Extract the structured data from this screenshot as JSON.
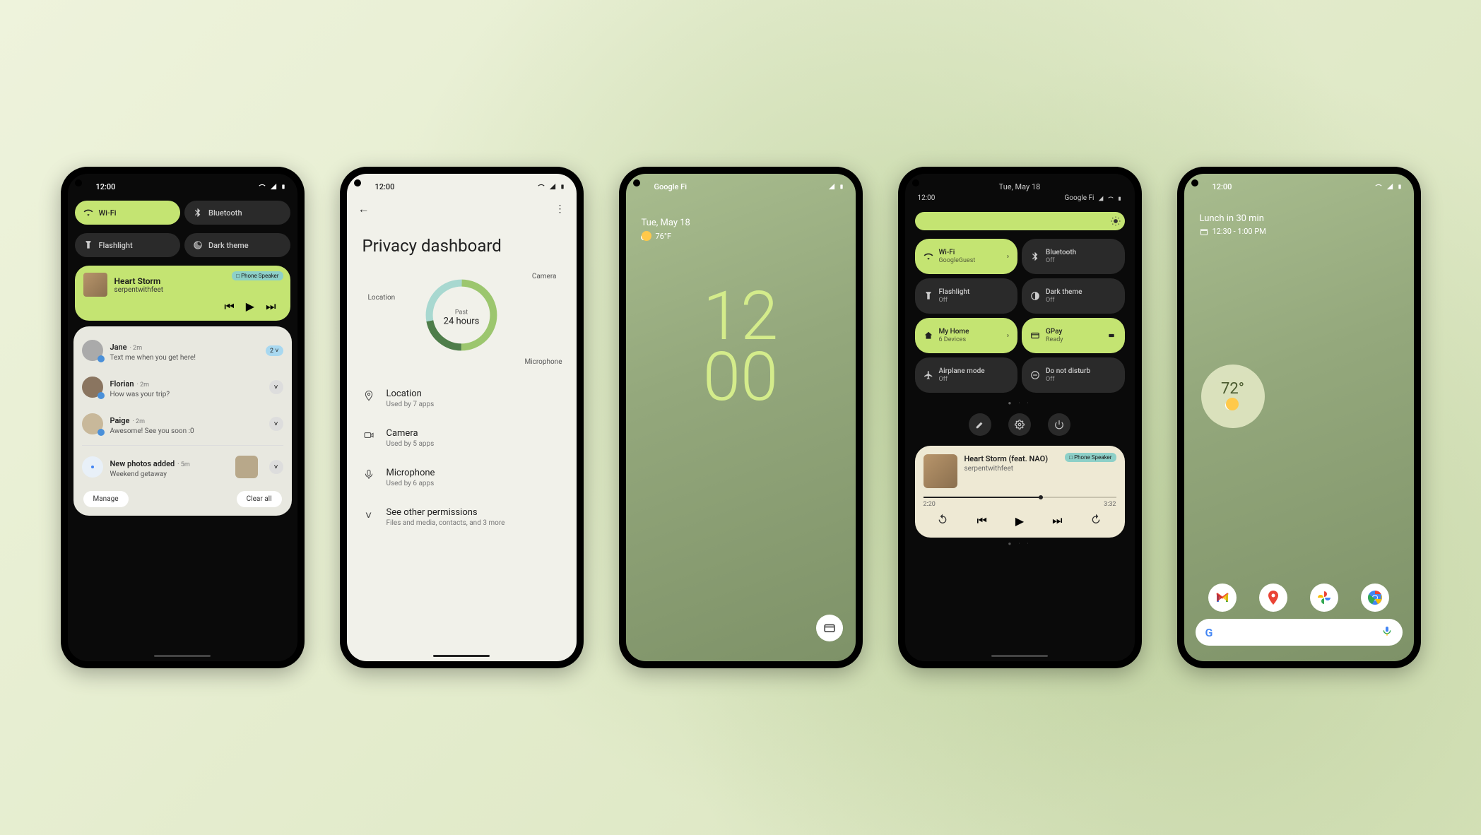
{
  "common": {
    "time": "12:00"
  },
  "phone1": {
    "qs": [
      {
        "label": "Wi-Fi",
        "on": true
      },
      {
        "label": "Bluetooth",
        "on": false
      },
      {
        "label": "Flashlight",
        "on": false
      },
      {
        "label": "Dark theme",
        "on": false
      }
    ],
    "media": {
      "badge": "□ Phone Speaker",
      "title": "Heart Storm",
      "artist": "serpentwithfeet"
    },
    "notifs": [
      {
        "name": "Jane",
        "time": "2m",
        "text": "Text me when you get here!",
        "badge": "2 ˅"
      },
      {
        "name": "Florian",
        "time": "2m",
        "text": "How was your trip?"
      },
      {
        "name": "Paige",
        "time": "2m",
        "text": "Awesome! See you soon :0"
      }
    ],
    "photo_notif": {
      "title": "New photos added",
      "time": "5m",
      "text": "Weekend getaway"
    },
    "actions": {
      "manage": "Manage",
      "clear": "Clear all"
    }
  },
  "phone2": {
    "title": "Privacy dashboard",
    "chart": {
      "past": "Past",
      "hours": "24 hours",
      "labels": {
        "location": "Location",
        "camera": "Camera",
        "microphone": "Microphone"
      }
    },
    "perms": [
      {
        "name": "Location",
        "sub": "Used by 7 apps"
      },
      {
        "name": "Camera",
        "sub": "Used by 5 apps"
      },
      {
        "name": "Microphone",
        "sub": "Used by 6 apps"
      },
      {
        "name": "See other permissions",
        "sub": "Files and media, contacts, and 3 more"
      }
    ]
  },
  "phone3": {
    "carrier": "Google Fi",
    "date": "Tue, May 18",
    "temp": "76°F",
    "clock_top": "12",
    "clock_bot": "00"
  },
  "phone4": {
    "date": "Tue, May 18",
    "sub_time": "12:00",
    "sub_carrier": "Google Fi",
    "tiles": [
      {
        "label": "Wi-Fi",
        "sub": "GoogleGuest",
        "on": true,
        "chevron": true
      },
      {
        "label": "Bluetooth",
        "sub": "Off",
        "on": false
      },
      {
        "label": "Flashlight",
        "sub": "Off",
        "on": false
      },
      {
        "label": "Dark theme",
        "sub": "Off",
        "on": false
      },
      {
        "label": "My Home",
        "sub": "6 Devices",
        "on": true,
        "chevron": true
      },
      {
        "label": "GPay",
        "sub": "Ready",
        "on": true
      },
      {
        "label": "Airplane mode",
        "sub": "Off",
        "on": false
      },
      {
        "label": "Do not disturb",
        "sub": "Off",
        "on": false
      }
    ],
    "media": {
      "badge": "□ Phone Speaker",
      "title": "Heart Storm (feat. NAO)",
      "artist": "serpentwithfeet",
      "elapsed": "2:20",
      "total": "3:32"
    }
  },
  "phone5": {
    "event_title": "Lunch in 30 min",
    "event_time": "12:30 - 1:00 PM",
    "temp": "72°",
    "dock": [
      "Gmail",
      "Maps",
      "Photos",
      "Chrome"
    ]
  }
}
